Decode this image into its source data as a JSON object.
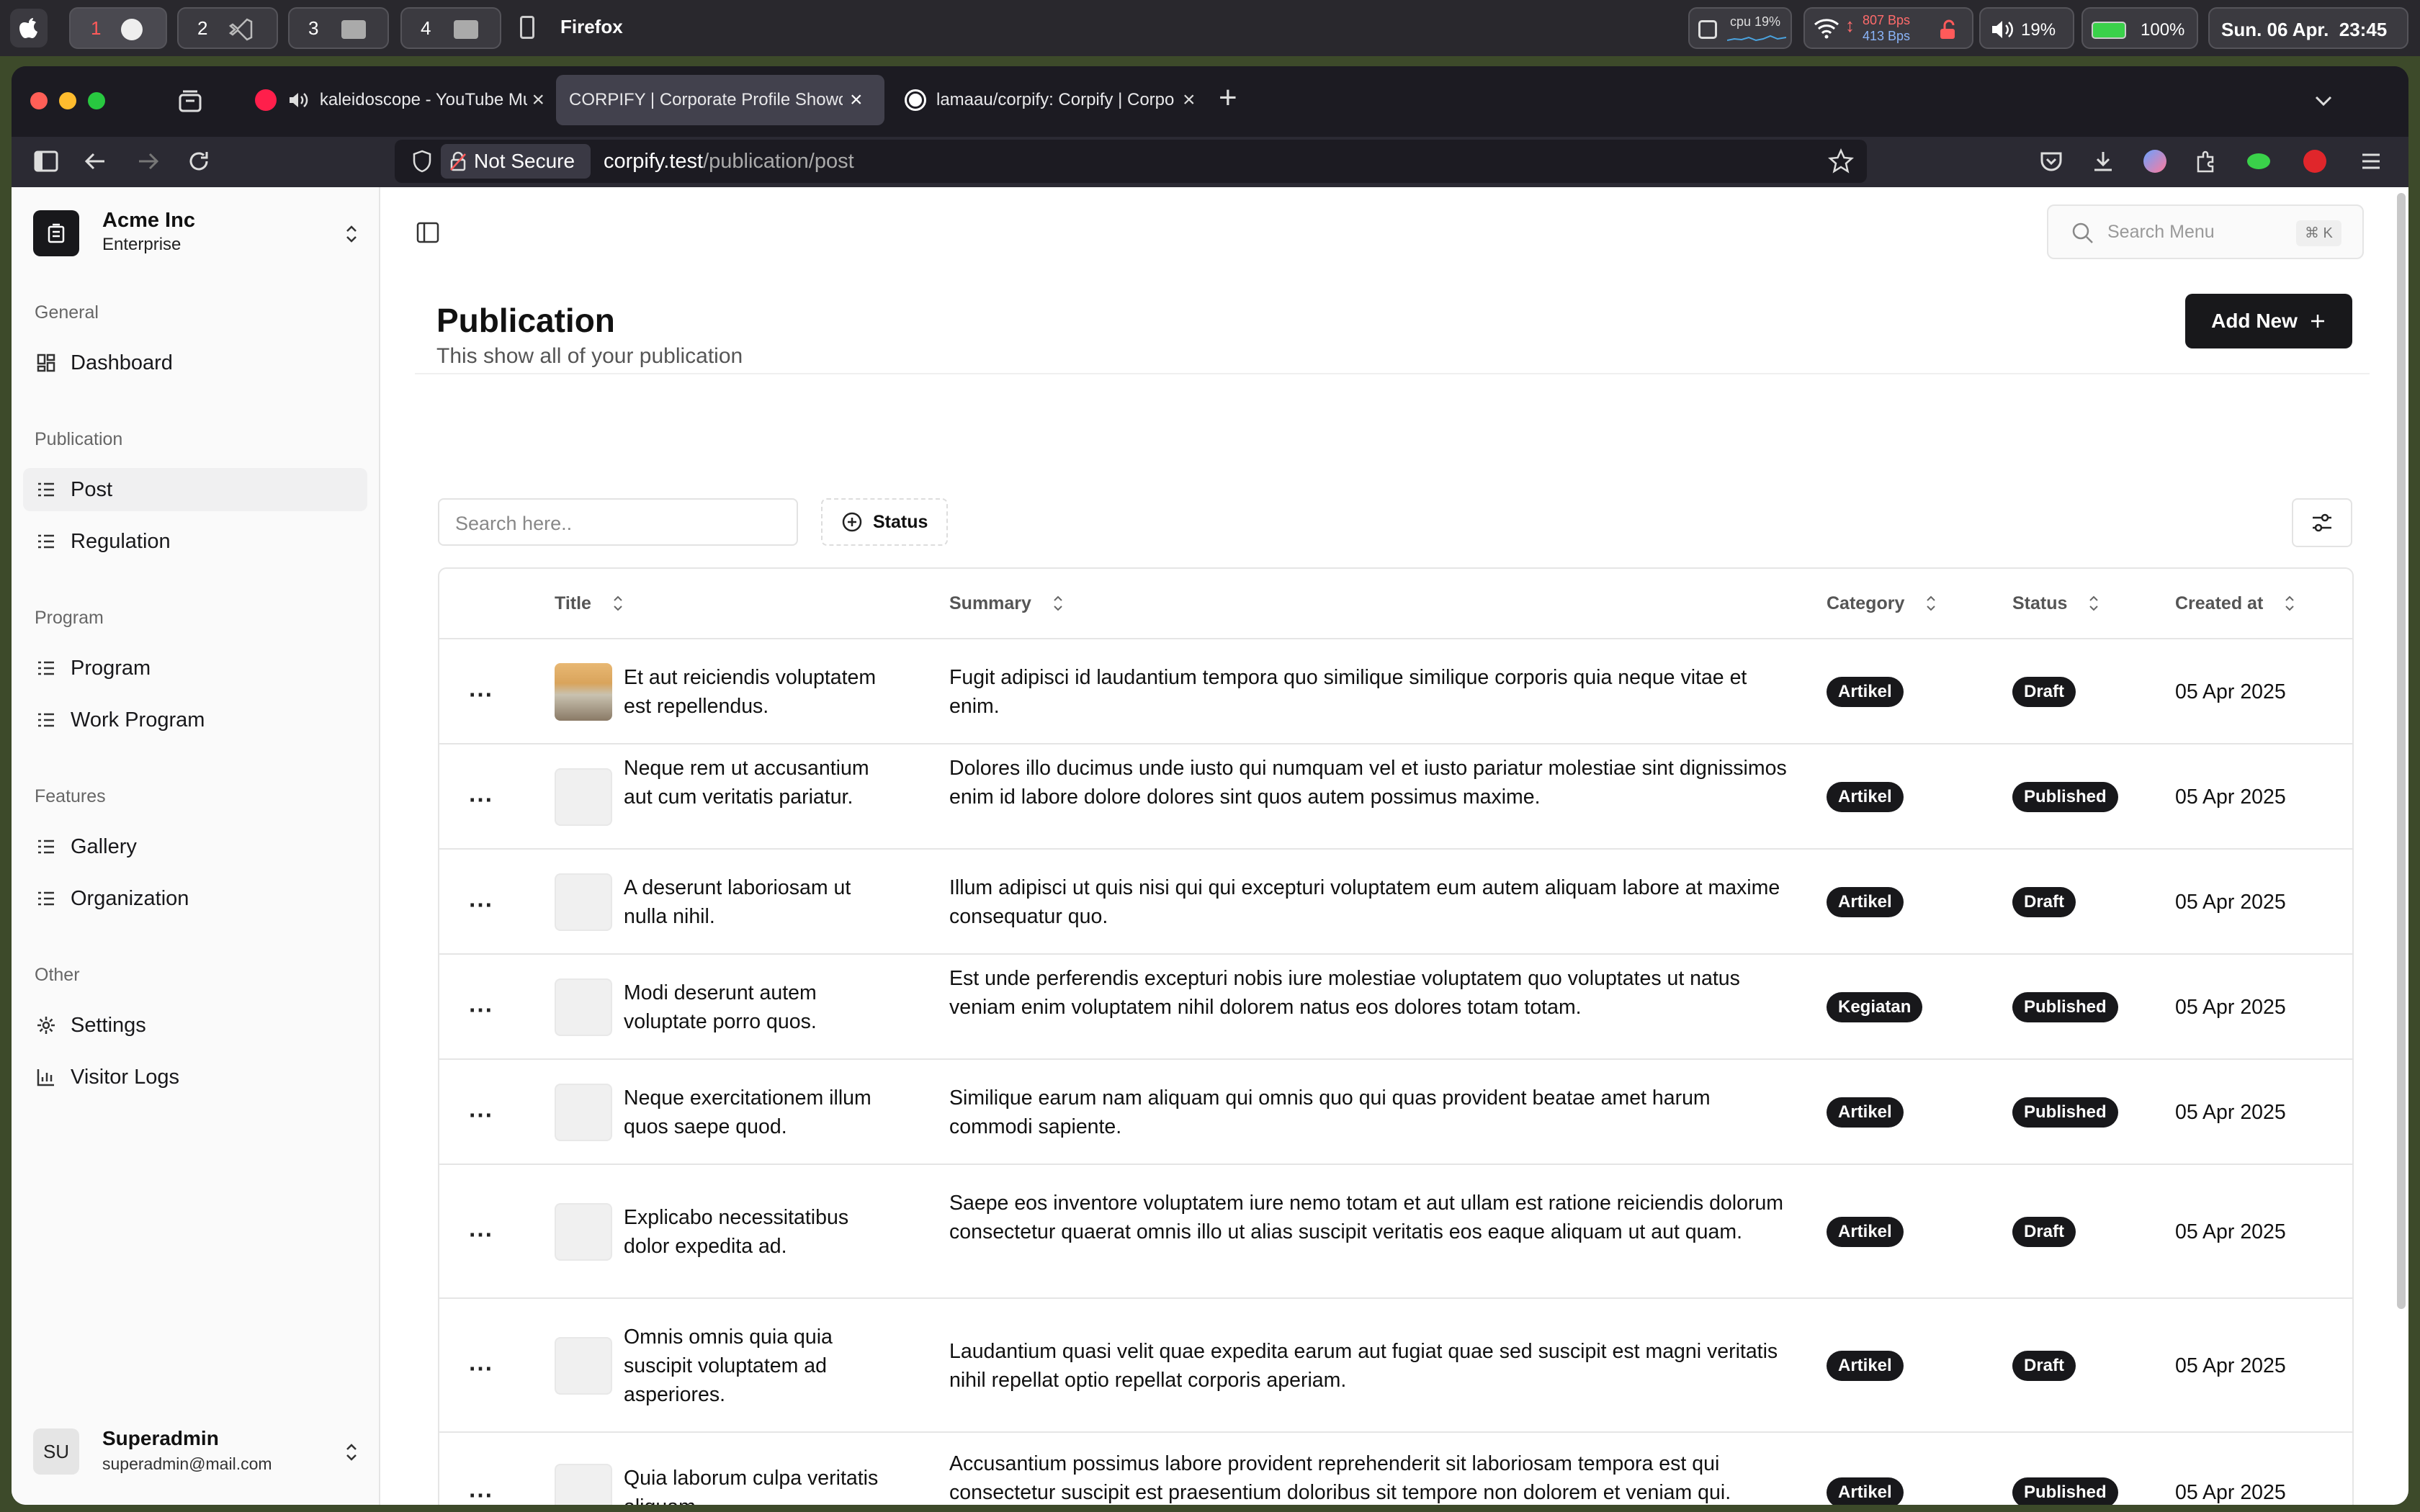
{
  "macos": {
    "spaces": [
      "1",
      "2",
      "3",
      "4"
    ],
    "active_app": "Firefox",
    "cpu": "cpu 19%",
    "net_up": "807 Bps",
    "net_down": "413 Bps",
    "volume": "19%",
    "battery": "100%",
    "datetime": "Sun. 06 Apr.  23:45"
  },
  "browser": {
    "tabs": [
      {
        "label": "kaleidoscope - YouTube Mu"
      },
      {
        "label": "CORPIFY | Corporate Profile Showca"
      },
      {
        "label": "lamaau/corpify: Corpify | Corpo"
      }
    ],
    "security_label": "Not Secure",
    "url_host": "corpify.test",
    "url_path": "/publication/post"
  },
  "sidebar": {
    "org_name": "Acme Inc",
    "org_plan": "Enterprise",
    "groups": [
      {
        "label": "General",
        "items": [
          {
            "label": "Dashboard"
          }
        ]
      },
      {
        "label": "Publication",
        "items": [
          {
            "label": "Post"
          },
          {
            "label": "Regulation"
          }
        ]
      },
      {
        "label": "Program",
        "items": [
          {
            "label": "Program"
          },
          {
            "label": "Work Program"
          }
        ]
      },
      {
        "label": "Features",
        "items": [
          {
            "label": "Gallery"
          },
          {
            "label": "Organization"
          }
        ]
      },
      {
        "label": "Other",
        "items": [
          {
            "label": "Settings"
          },
          {
            "label": "Visitor Logs"
          }
        ]
      }
    ],
    "user": {
      "initials": "SU",
      "name": "Superadmin",
      "email": "superadmin@mail.com"
    }
  },
  "header": {
    "search_placeholder": "Search Menu",
    "search_shortcut": "⌘ K"
  },
  "page": {
    "title": "Publication",
    "subtitle": "This show all of your publication",
    "add_new_label": "Add New"
  },
  "filters": {
    "search_placeholder": "Search here..",
    "status_label": "Status"
  },
  "table": {
    "columns": [
      "Title",
      "Summary",
      "Category",
      "Status",
      "Created at"
    ],
    "rows": [
      {
        "title": "Et aut reiciendis voluptatem est repellendus.",
        "summary": "Fugit adipisci id laudantium tempora quo similique similique corporis quia neque vitae et enim.",
        "category": "Artikel",
        "status": "Draft",
        "created": "05 Apr 2025"
      },
      {
        "title": "Neque rem ut accusantium aut cum veritatis pariatur.",
        "summary": "Dolores illo ducimus unde iusto qui numquam vel et iusto pariatur molestiae sint dignissimos enim id labore dolore dolores sint quos autem possimus maxime.",
        "category": "Artikel",
        "status": "Published",
        "created": "05 Apr 2025"
      },
      {
        "title": "A deserunt laboriosam ut nulla nihil.",
        "summary": "Illum adipisci ut quis nisi qui qui excepturi voluptatem eum autem aliquam labore at maxime consequatur quo.",
        "category": "Artikel",
        "status": "Draft",
        "created": "05 Apr 2025"
      },
      {
        "title": "Modi deserunt autem voluptate porro quos.",
        "summary": "Est unde perferendis excepturi nobis iure molestiae voluptatem quo voluptates ut natus veniam enim voluptatem nihil dolorem natus eos dolores totam totam.",
        "category": "Kegiatan",
        "status": "Published",
        "created": "05 Apr 2025"
      },
      {
        "title": "Neque exercitationem illum quos saepe quod.",
        "summary": "Similique earum nam aliquam qui omnis quo qui quas provident beatae amet harum commodi sapiente.",
        "category": "Artikel",
        "status": "Published",
        "created": "05 Apr 2025"
      },
      {
        "title": "Explicabo necessitatibus dolor expedita ad.",
        "summary": "Saepe eos inventore voluptatem iure nemo totam et aut ullam est ratione reiciendis dolorum consectetur quaerat omnis illo ut alias suscipit veritatis eos eaque aliquam ut aut quam.",
        "category": "Artikel",
        "status": "Draft",
        "created": "05 Apr 2025"
      },
      {
        "title": "Omnis omnis quia quia suscipit voluptatem ad asperiores.",
        "summary": "Laudantium quasi velit quae expedita earum aut fugiat quae sed suscipit est magni veritatis nihil repellat optio repellat corporis aperiam.",
        "category": "Artikel",
        "status": "Draft",
        "created": "05 Apr 2025"
      },
      {
        "title": "Quia laborum culpa veritatis aliquam.",
        "summary": "Accusantium possimus labore provident reprehenderit sit laboriosam tempora est qui consectetur suscipit est praesentium doloribus sit tempore non dolorem et veniam qui.",
        "category": "Artikel",
        "status": "Published",
        "created": "05 Apr 2025"
      }
    ]
  },
  "colors": {
    "accent": "#18181b",
    "sidebar_bg": "#fafafa",
    "browser_chrome": "#2b2a33"
  }
}
